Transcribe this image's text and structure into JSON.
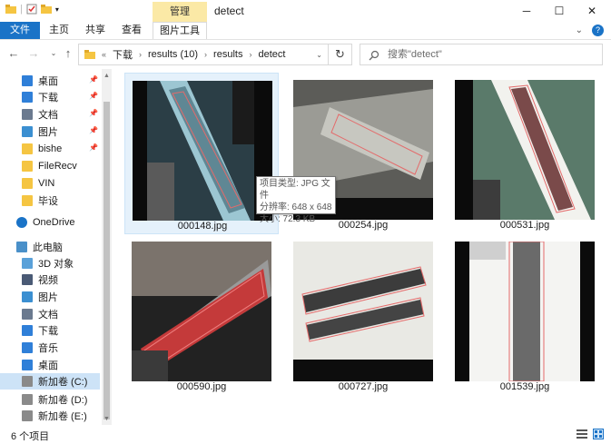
{
  "window": {
    "title": "detect"
  },
  "ribbon": {
    "context_group": "管理",
    "tabs": [
      "文件",
      "主页",
      "共享",
      "查看",
      "图片工具"
    ]
  },
  "address": {
    "overflow": "«",
    "crumbs": [
      "下载",
      "results (10)",
      "results",
      "detect"
    ]
  },
  "search": {
    "placeholder": "搜索\"detect\""
  },
  "sidebar": {
    "items": [
      {
        "label": "桌面",
        "icon": "desktop-icon",
        "pinned": true
      },
      {
        "label": "下载",
        "icon": "download-icon",
        "pinned": true
      },
      {
        "label": "文档",
        "icon": "document-icon",
        "pinned": true
      },
      {
        "label": "图片",
        "icon": "picture-icon",
        "pinned": true
      },
      {
        "label": "bishe",
        "icon": "folder-icon",
        "pinned": true
      },
      {
        "label": "FileRecv",
        "icon": "folder-icon",
        "pinned": false
      },
      {
        "label": "VIN",
        "icon": "folder-icon",
        "pinned": false
      },
      {
        "label": "毕设",
        "icon": "folder-icon",
        "pinned": false
      },
      {
        "label": "OneDrive",
        "icon": "cloud-icon",
        "pinned": false
      },
      {
        "label": "此电脑",
        "icon": "computer-icon",
        "pinned": false
      },
      {
        "label": "3D 对象",
        "icon": "3d-objects-icon",
        "pinned": false
      },
      {
        "label": "视频",
        "icon": "video-icon",
        "pinned": false
      },
      {
        "label": "图片",
        "icon": "picture-icon",
        "pinned": false
      },
      {
        "label": "文档",
        "icon": "document-icon",
        "pinned": false
      },
      {
        "label": "下载",
        "icon": "download-icon",
        "pinned": false
      },
      {
        "label": "音乐",
        "icon": "music-icon",
        "pinned": false
      },
      {
        "label": "桌面",
        "icon": "desktop-icon",
        "pinned": false
      },
      {
        "label": "新加卷 (C:)",
        "icon": "drive-icon",
        "pinned": false
      },
      {
        "label": "新加卷 (D:)",
        "icon": "drive-icon",
        "pinned": false
      },
      {
        "label": "新加卷 (E:)",
        "icon": "drive-icon",
        "pinned": false
      }
    ]
  },
  "files": [
    {
      "name": "000148.jpg"
    },
    {
      "name": "000254.jpg"
    },
    {
      "name": "000531.jpg"
    },
    {
      "name": "000590.jpg"
    },
    {
      "name": "000727.jpg"
    },
    {
      "name": "001539.jpg"
    }
  ],
  "tooltip": {
    "type": "项目类型: JPG 文件",
    "resolution": "分辨率: 648 x 648",
    "size": "大小: 72.3 KB"
  },
  "status": {
    "count": "6 个项目"
  },
  "colors": {
    "accent": "#1a73c7",
    "context_tab": "#fbe9a6",
    "selection": "#cde3f7",
    "hover": "#e5f1fb"
  }
}
